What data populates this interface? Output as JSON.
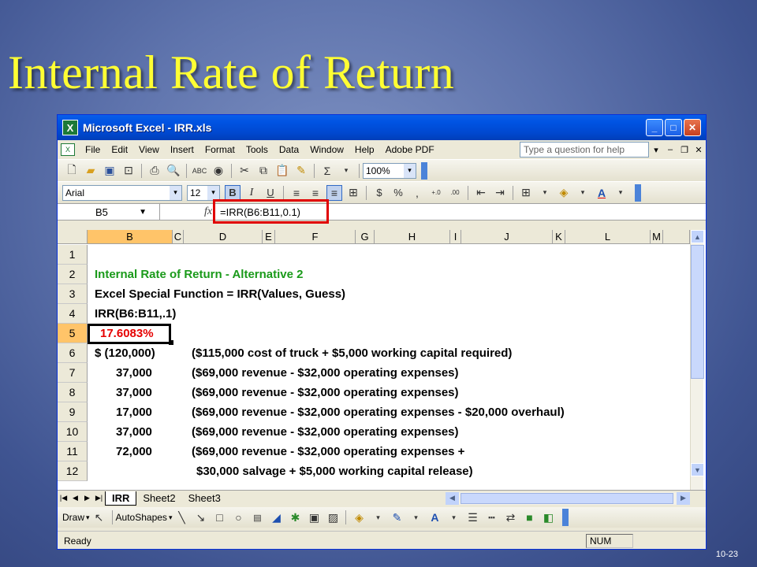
{
  "slide": {
    "title": "Internal Rate of Return",
    "page_number": "10-23"
  },
  "window": {
    "title": "Microsoft Excel - IRR.xls"
  },
  "menu": [
    "File",
    "Edit",
    "View",
    "Insert",
    "Format",
    "Tools",
    "Data",
    "Window",
    "Help",
    "Adobe PDF"
  ],
  "help_placeholder": "Type a question for help",
  "toolbar": {
    "zoom": "100%",
    "font_name": "Arial",
    "font_size": "12"
  },
  "formula_bar": {
    "name_box": "B5",
    "fx": "fx",
    "formula": "=IRR(B6:B11,0.1)"
  },
  "columns": [
    "B",
    "C",
    "D",
    "E",
    "F",
    "G",
    "H",
    "I",
    "J",
    "K",
    "L",
    "M"
  ],
  "rows": [
    "1",
    "2",
    "3",
    "4",
    "5",
    "6",
    "7",
    "8",
    "9",
    "10",
    "11",
    "12"
  ],
  "cells": {
    "r2": "Internal Rate of Return - Alternative 2",
    "r3": "Excel Special Function = IRR(Values, Guess)",
    "r4": "IRR(B6:B11,.1)",
    "r5": "17.6083%",
    "r6_b": "$ (120,000)",
    "r6_d": "($115,000 cost of truck + $5,000 working capital required)",
    "r7_b": "37,000",
    "r7_d": "($69,000 revenue - $32,000 operating expenses)",
    "r8_b": "37,000",
    "r8_d": "($69,000 revenue - $32,000 operating expenses)",
    "r9_b": "17,000",
    "r9_d": "($69,000 revenue - $32,000 operating expenses - $20,000 overhaul)",
    "r10_b": "37,000",
    "r10_d": "($69,000 revenue - $32,000 operating expenses)",
    "r11_b": "72,000",
    "r11_d": "($69,000 revenue - $32,000 operating expenses +",
    "r12_d": "$30,000 salvage + $5,000 working capital release)"
  },
  "sheets": [
    "IRR",
    "Sheet2",
    "Sheet3"
  ],
  "drawing": {
    "draw": "Draw",
    "autoshapes": "AutoShapes"
  },
  "status": {
    "left": "Ready",
    "num": "NUM"
  },
  "colors": {
    "title": "#ffff33",
    "highlight_border": "#e00000",
    "title_green": "#1a9a1a",
    "result_red": "#e60000"
  }
}
